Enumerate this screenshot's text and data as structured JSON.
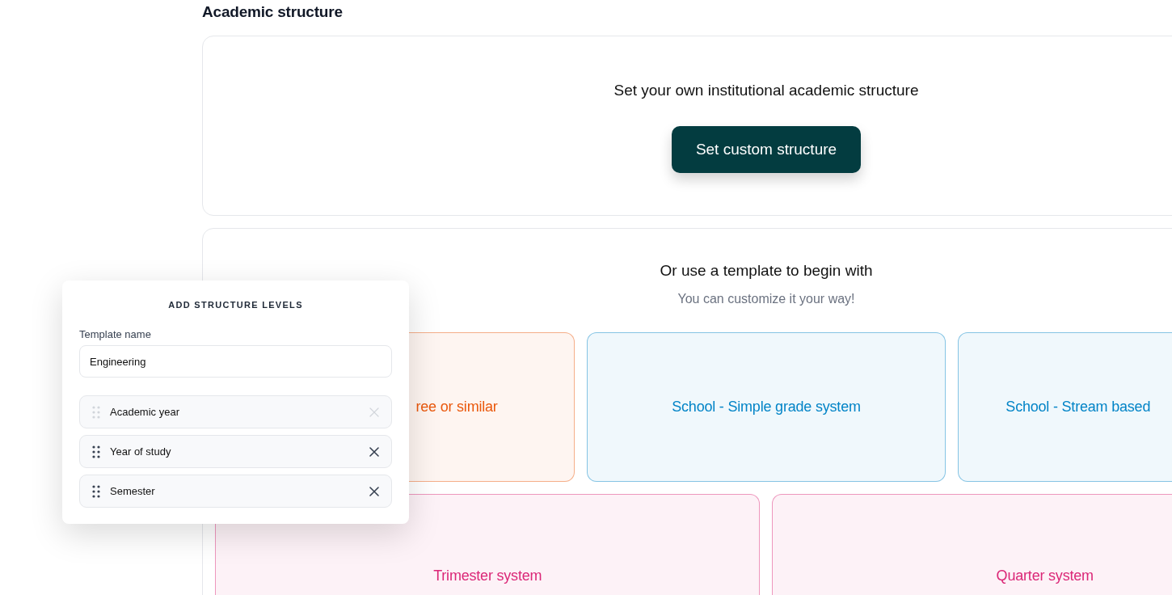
{
  "page_title": "Academic structure",
  "custom": {
    "heading": "Set your own institutional academic structure",
    "button": "Set custom structure"
  },
  "templates": {
    "heading": "Or use a template to begin with",
    "subheading": "You can customize it your way!",
    "cards": [
      {
        "label": "ree or similar",
        "color": "#ea580c"
      },
      {
        "label": "School - Simple grade system",
        "color": "#0284c7"
      },
      {
        "label": "School - Stream based",
        "color": "#0284c7"
      },
      {
        "label": "Trimester system",
        "color": "#db2777"
      },
      {
        "label": "Quarter system",
        "color": "#db2777"
      }
    ]
  },
  "popover": {
    "title": "ADD STRUCTURE LEVELS",
    "field_label": "Template name",
    "field_value": "Engineering",
    "levels": [
      {
        "label": "Academic year",
        "disabled": true
      },
      {
        "label": "Year of study",
        "disabled": false
      },
      {
        "label": "Semester",
        "disabled": false
      }
    ]
  }
}
